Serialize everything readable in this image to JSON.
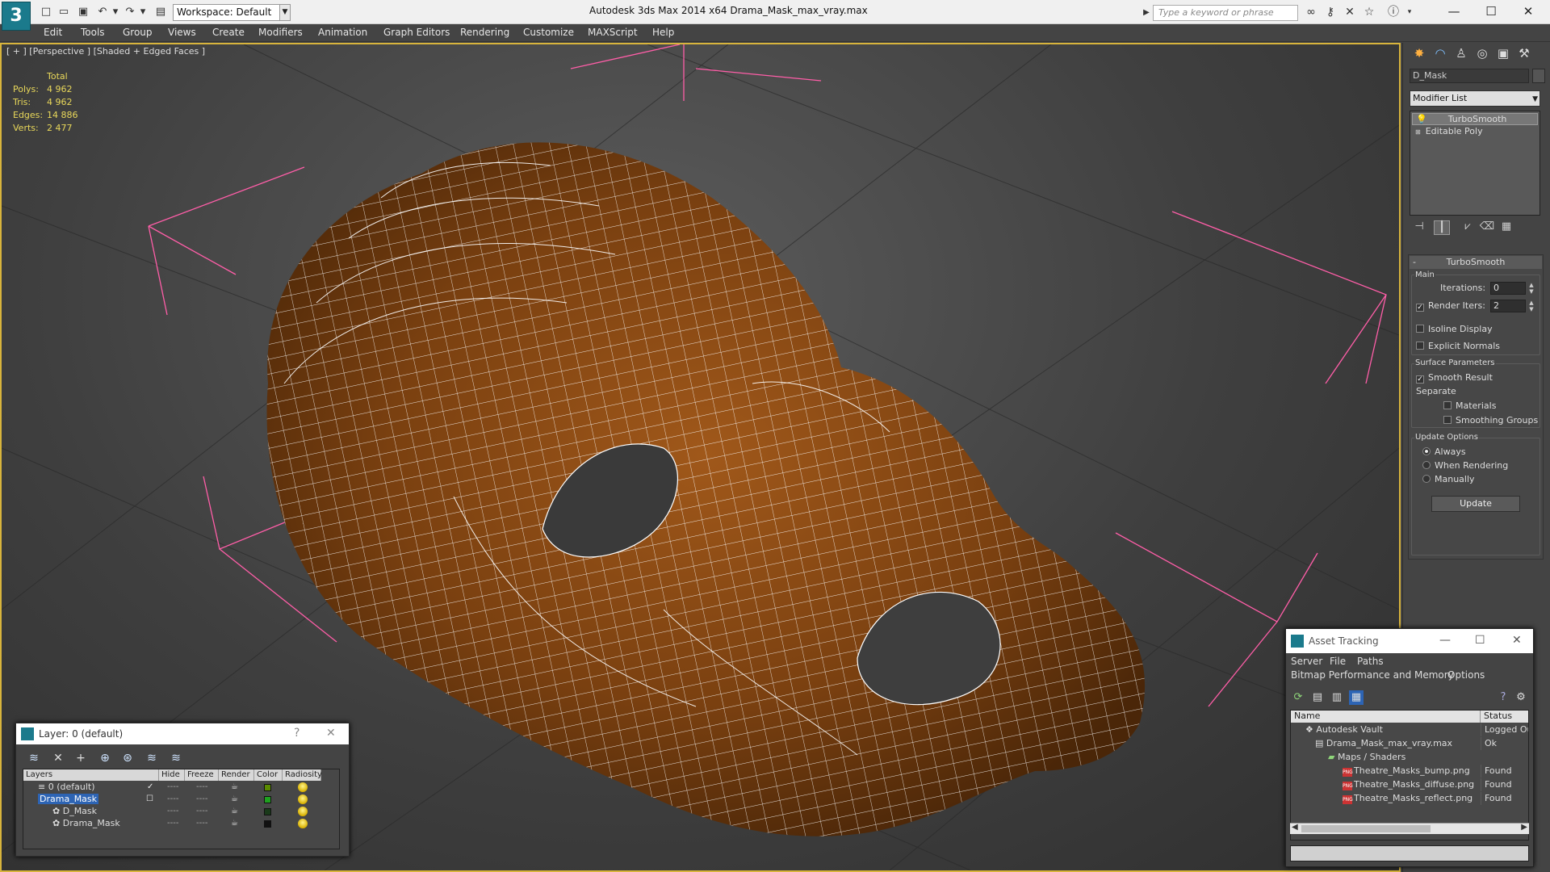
{
  "app": {
    "title": "Autodesk 3ds Max  2014 x64      Drama_Mask_max_vray.max",
    "logo": "3ds-max-logo",
    "workspace": "Workspace: Default",
    "search_placeholder": "Type a keyword or phrase"
  },
  "menu": [
    "Edit",
    "Tools",
    "Group",
    "Views",
    "Create",
    "Modifiers",
    "Animation",
    "Graph Editors",
    "Rendering",
    "Customize",
    "MAXScript",
    "Help"
  ],
  "viewport": {
    "label": "[ + ] [Perspective ] [Shaded + Edged Faces ]",
    "stats": {
      "header": "Total",
      "rows": [
        {
          "label": "Polys:",
          "value": "4 962"
        },
        {
          "label": "Tris:",
          "value": "4 962"
        },
        {
          "label": "Edges:",
          "value": "14 886"
        },
        {
          "label": "Verts:",
          "value": "2 477"
        }
      ]
    }
  },
  "command_panel": {
    "object_name": "D_Mask",
    "modifier_list": "Modifier List",
    "stack": [
      "TurboSmooth",
      "Editable Poly"
    ],
    "rollout": {
      "title": "TurboSmooth",
      "main_label": "Main",
      "iterations_label": "Iterations:",
      "iterations": "0",
      "render_iters_label": "Render Iters:",
      "render_iters": "2",
      "isoline": "Isoline Display",
      "explicit": "Explicit Normals",
      "surface_label": "Surface Parameters",
      "smooth_result": "Smooth Result",
      "separate_label": "Separate",
      "materials": "Materials",
      "smoothing_groups": "Smoothing Groups",
      "update_label": "Update Options",
      "always": "Always",
      "when_rendering": "When Rendering",
      "manually": "Manually",
      "update_button": "Update"
    }
  },
  "layer_window": {
    "title": "Layer: 0 (default)",
    "help": "?",
    "columns": [
      "Layers",
      "Hide",
      "Freeze",
      "Render",
      "Color",
      "Radiosity"
    ],
    "rows": [
      {
        "name": "0 (default)",
        "color": "#5a8a00"
      },
      {
        "name": "Drama_Mask",
        "color": "#1fa01f"
      },
      {
        "name": "D_Mask",
        "color": "#1a3a1a"
      },
      {
        "name": "Drama_Mask",
        "color": "#111111"
      }
    ],
    "dash": "----"
  },
  "asset_window": {
    "title": "Asset Tracking",
    "menu_row1": [
      "Server",
      "File",
      "Paths"
    ],
    "menu_row2": [
      "Bitmap Performance and Memory",
      "Options"
    ],
    "columns": [
      "Name",
      "Status"
    ],
    "rows": [
      {
        "name": "Autodesk Vault",
        "status": "Logged Out"
      },
      {
        "name": "Drama_Mask_max_vray.max",
        "status": "Ok"
      },
      {
        "name": "Maps / Shaders",
        "status": ""
      },
      {
        "name": "Theatre_Masks_bump.png",
        "status": "Found"
      },
      {
        "name": "Theatre_Masks_diffuse.png",
        "status": "Found"
      },
      {
        "name": "Theatre_Masks_reflect.png",
        "status": "Found"
      }
    ],
    "png_tag": "PNG"
  },
  "colors": {
    "viewport_border": "#d8b43c",
    "selection": "#2d64b4",
    "mask": "#8a4a12",
    "wire": "#ffffff",
    "grid_lines": "#ff5ea8"
  }
}
